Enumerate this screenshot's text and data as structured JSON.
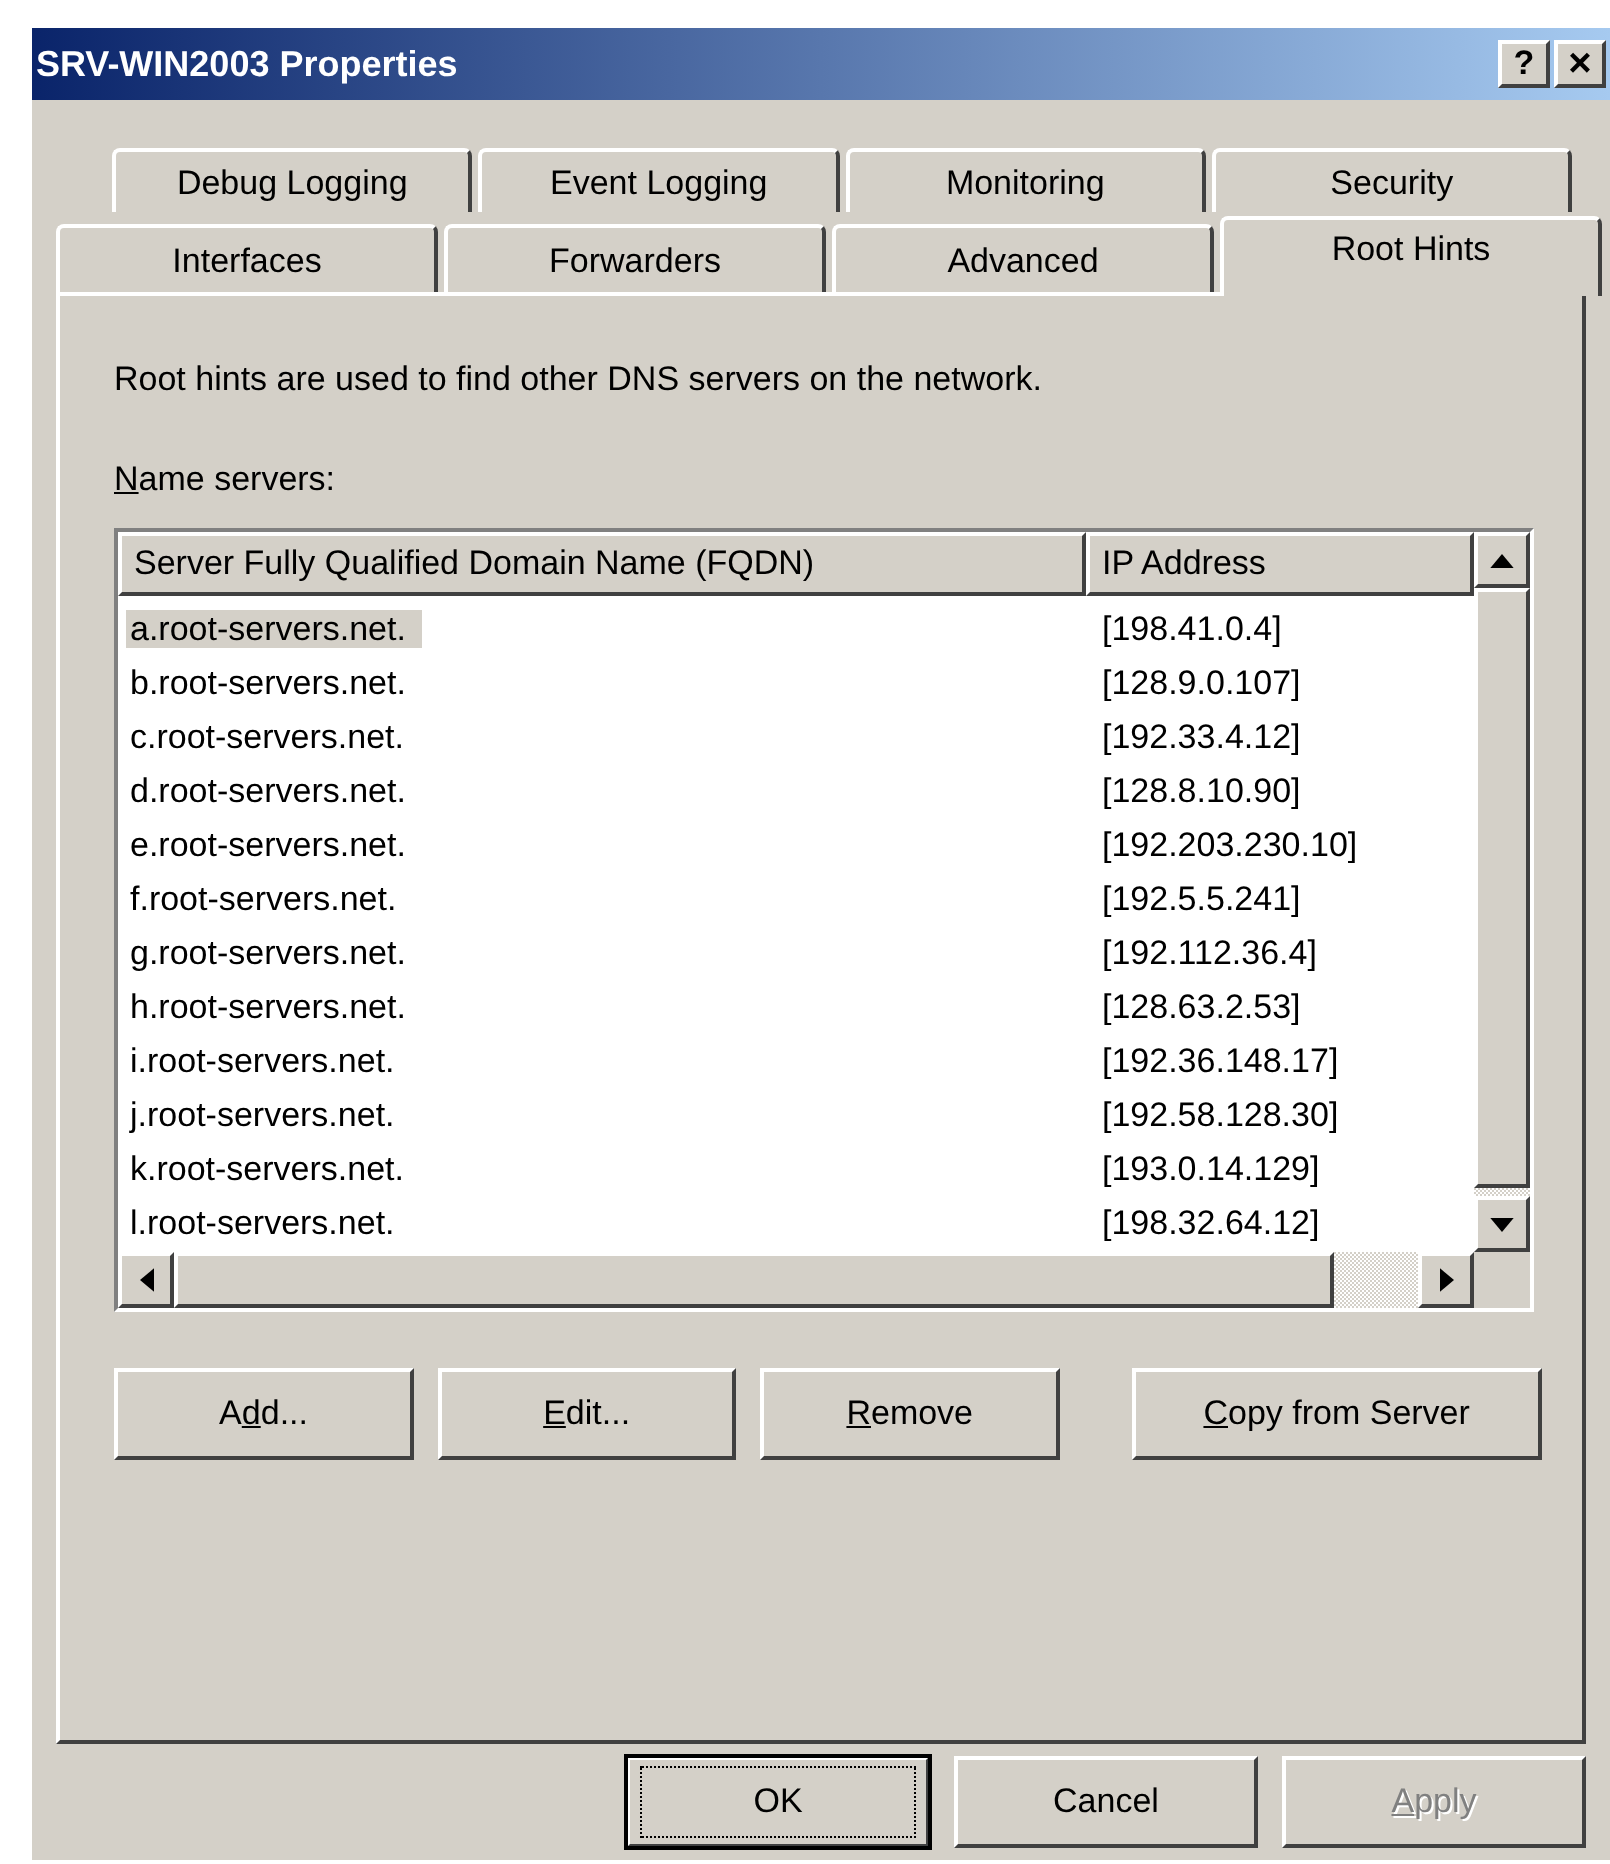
{
  "window": {
    "title": "SRV-WIN2003 Properties"
  },
  "title_buttons": [
    {
      "kind": "help",
      "label": "?"
    },
    {
      "kind": "close",
      "label": "×"
    }
  ],
  "tab_rows": [
    [
      {
        "label": "Debug Logging",
        "selected": false
      },
      {
        "label": "Event Logging",
        "selected": false
      },
      {
        "label": "Monitoring",
        "selected": false
      },
      {
        "label": "Security",
        "selected": false
      }
    ],
    [
      {
        "label": "Interfaces",
        "selected": false
      },
      {
        "label": "Forwarders",
        "selected": false
      },
      {
        "label": "Advanced",
        "selected": false
      },
      {
        "label": "Root Hints",
        "selected": true
      }
    ]
  ],
  "description": "Root hints are used to find other DNS servers on the network.",
  "list_label": {
    "key": "N",
    "post": "ame servers:"
  },
  "table": {
    "columns": [
      "Server Fully Qualified Domain Name (FQDN)",
      "IP Address"
    ],
    "rows": [
      {
        "name": "a.root-servers.net.",
        "ip": "[198.41.0.4]",
        "selected": true
      },
      {
        "name": "b.root-servers.net.",
        "ip": "[128.9.0.107]",
        "selected": false
      },
      {
        "name": "c.root-servers.net.",
        "ip": "[192.33.4.12]",
        "selected": false
      },
      {
        "name": "d.root-servers.net.",
        "ip": "[128.8.10.90]",
        "selected": false
      },
      {
        "name": "e.root-servers.net.",
        "ip": "[192.203.230.10]",
        "selected": false
      },
      {
        "name": "f.root-servers.net.",
        "ip": "[192.5.5.241]",
        "selected": false
      },
      {
        "name": "g.root-servers.net.",
        "ip": "[192.112.36.4]",
        "selected": false
      },
      {
        "name": "h.root-servers.net.",
        "ip": "[128.63.2.53]",
        "selected": false
      },
      {
        "name": "i.root-servers.net.",
        "ip": "[192.36.148.17]",
        "selected": false
      },
      {
        "name": "j.root-servers.net.",
        "ip": "[192.58.128.30]",
        "selected": false
      },
      {
        "name": "k.root-servers.net.",
        "ip": "[193.0.14.129]",
        "selected": false
      },
      {
        "name": "l.root-servers.net.",
        "ip": "[198.32.64.12]",
        "selected": false
      }
    ]
  },
  "list_buttons": [
    {
      "pre": "A",
      "key": "d",
      "post": "d...",
      "disabled": false
    },
    {
      "key": "E",
      "post": "dit...",
      "disabled": false
    },
    {
      "key": "R",
      "post": "emove",
      "disabled": false
    },
    {
      "key": "C",
      "post": "opy from Server",
      "disabled": false
    }
  ],
  "dialog_buttons": [
    {
      "pre": "OK",
      "default": true,
      "disabled": false
    },
    {
      "pre": "Cancel",
      "default": false,
      "disabled": false
    },
    {
      "key": "A",
      "post": "pply",
      "default": false,
      "disabled": true
    }
  ]
}
